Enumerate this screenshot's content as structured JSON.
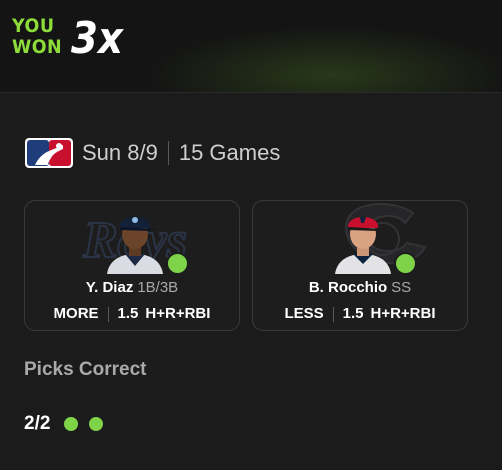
{
  "header": {
    "you_label": "YOU",
    "won_label": "WON",
    "multiplier": "3x",
    "accent_color": "#8ddc3a"
  },
  "game": {
    "league_icon": "mlb-logo-icon",
    "date": "Sun 8/9",
    "count": "15 Games"
  },
  "picks": [
    {
      "name": "Y. Diaz",
      "position": "1B/3B",
      "direction": "MORE",
      "line": "1.5",
      "stat": "H+R+RBI",
      "team_icon": "rays-logo-icon",
      "result_icon": "check-dot-icon",
      "result_color": "#7ed348"
    },
    {
      "name": "B. Rocchio",
      "position": "SS",
      "direction": "LESS",
      "line": "1.5",
      "stat": "H+R+RBI",
      "team_icon": "guardians-logo-icon",
      "result_icon": "check-dot-icon",
      "result_color": "#7ed348"
    }
  ],
  "summary": {
    "title": "Picks Correct",
    "count": "2/2",
    "correct": 2,
    "total": 2
  }
}
